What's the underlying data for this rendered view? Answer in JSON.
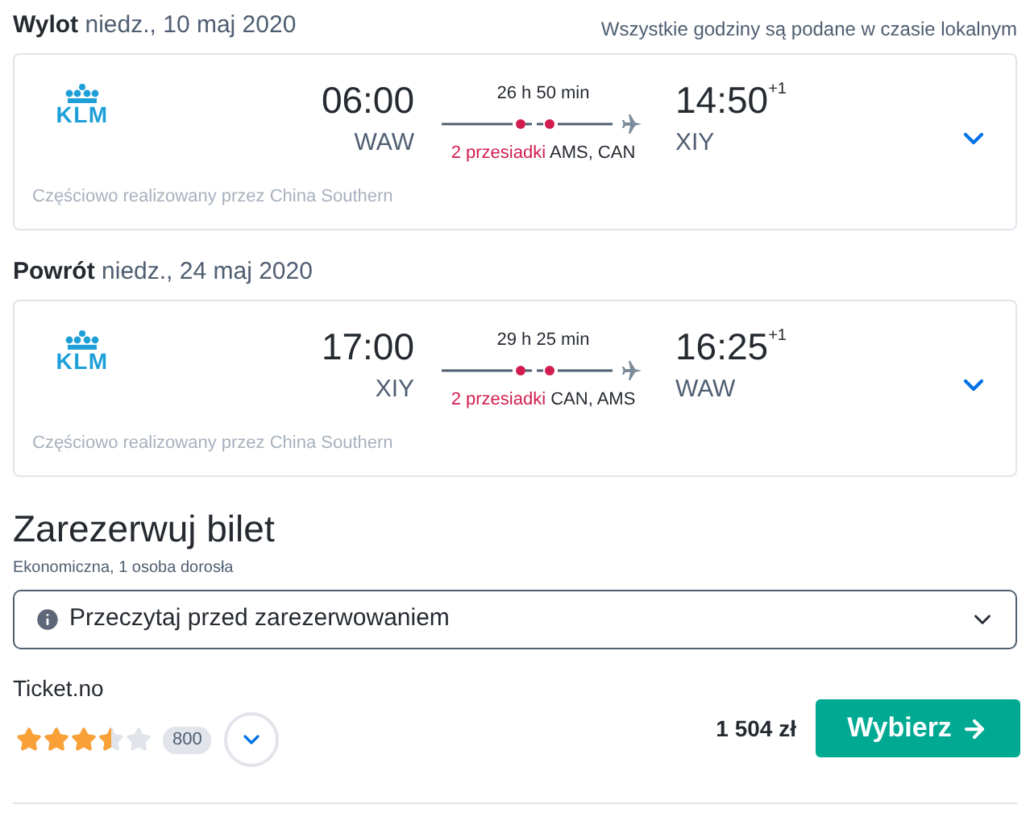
{
  "legs": [
    {
      "label": "Wylot",
      "date": "niedz., 10 maj 2020",
      "note": "Wszystkie godziny są podane w czasie lokalnym",
      "airline_logo": "KLM",
      "departure_time": "06:00",
      "departure_airport": "WAW",
      "duration": "26 h 50 min",
      "stops": "2 przesiadki",
      "stop_airports": "AMS, CAN",
      "arrival_time": "14:50",
      "day_offset": "+1",
      "arrival_airport": "XIY",
      "operated_by": "Częściowo realizowany przez China Southern",
      "expanded": false
    },
    {
      "label": "Powrót",
      "date": "niedz., 24 maj 2020",
      "airline_logo": "KLM",
      "departure_time": "17:00",
      "departure_airport": "XIY",
      "duration": "29 h 25 min",
      "stops": "2 przesiadki",
      "stop_airports": "CAN, AMS",
      "arrival_time": "16:25",
      "day_offset": "+1",
      "arrival_airport": "WAW",
      "operated_by": "Częściowo realizowany przez China Southern",
      "expanded": false
    }
  ],
  "booking": {
    "title": "Zarezerwuj bilet",
    "subtitle": "Ekonomiczna, 1 osoba dorosła",
    "notice": "Przeczytaj przed zarezerwowaniem",
    "provider": "Ticket.no",
    "stars": 3.5,
    "review_count": "800",
    "price": "1 504 zł",
    "button": "Wybierz"
  }
}
